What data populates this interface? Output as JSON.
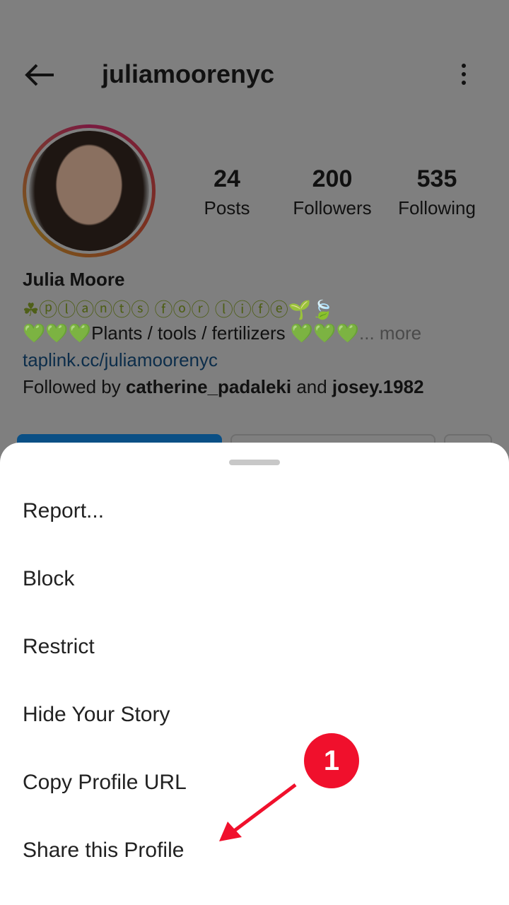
{
  "header": {
    "username": "juliamoorenyc",
    "back_icon": "arrow-left-icon",
    "menu_icon": "more-vertical-icon"
  },
  "stats": [
    {
      "value": "24",
      "label": "Posts"
    },
    {
      "value": "200",
      "label": "Followers"
    },
    {
      "value": "535",
      "label": "Following"
    }
  ],
  "profile": {
    "name": "Julia Moore",
    "bio_line1": "☘ⓟⓛⓐⓝⓣⓢ ⓕⓞⓡ ⓛⓘⓕⓔ🌱🍃",
    "hearts": "💚💚💚",
    "bio_line2": "Plants / tools / fertilizers ",
    "more": "... more",
    "link": "taplink.cc/juliamoorenyc",
    "followed_prefix": "Followed by ",
    "followed_user1": "catherine_padaleki",
    "followed_and": " and ",
    "followed_user2": "josey.1982"
  },
  "sheet": {
    "items": [
      "Report...",
      "Block",
      "Restrict",
      "Hide Your Story",
      "Copy Profile URL",
      "Share this Profile"
    ]
  },
  "annotation": {
    "badge": "1",
    "color": "#f0102c"
  }
}
